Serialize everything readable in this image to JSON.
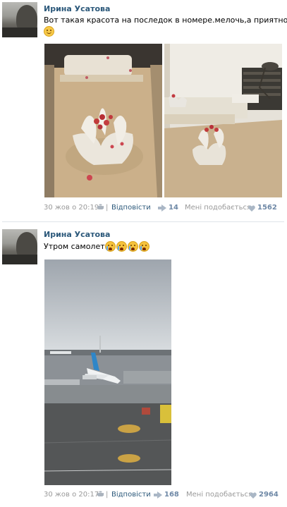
{
  "posts": [
    {
      "author": "Ирина Усатова",
      "text": "Вот такая красота на последок в номере.мелочь,а приятно",
      "emoji": [
        "smile-emoji"
      ],
      "date": "30 жов о 20:19",
      "source_label": "Відповісти",
      "share_count": "14",
      "like_label": "Мені подобається",
      "like_count": "1562"
    },
    {
      "author": "Ирина Усатова",
      "text": "Утром самолет",
      "emoji": [
        "crying-emoji",
        "crying-emoji",
        "crying-emoji",
        "crying-emoji"
      ],
      "date": "30 жов о 20:17",
      "source_label": "Відповісти",
      "share_count": "168",
      "like_label": "Мені подобається",
      "like_count": "2964"
    }
  ],
  "colors": {
    "author": "#2b587a",
    "meta": "#999999",
    "counts": "#6e88a6"
  }
}
